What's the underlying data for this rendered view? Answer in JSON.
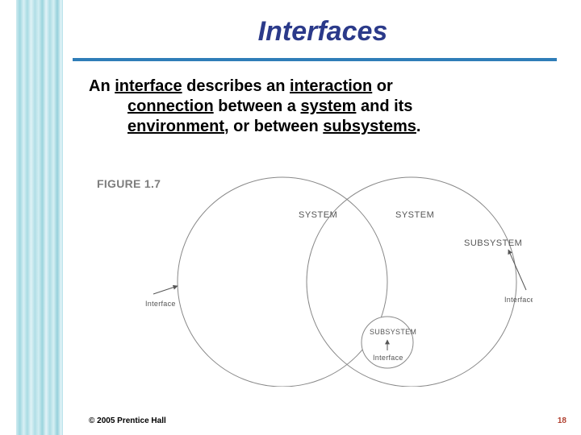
{
  "title": "Interfaces",
  "body": {
    "line1_a": "An ",
    "line1_b": "interface",
    "line1_c": " describes an ",
    "line1_d": "interaction",
    "line1_e": " or",
    "line2_a": "connection",
    "line2_b": " between a ",
    "line2_c": "system",
    "line2_d": " and its",
    "line3_a": "environment,",
    "line3_b": " or between ",
    "line3_c": "subsystems",
    "line3_d": "."
  },
  "figure": {
    "caption": "FIGURE 1.7",
    "labels": {
      "system_left": "SYSTEM",
      "system_right": "SYSTEM",
      "subsystem": "SUBSYSTEM",
      "subsystem_small": "SUBSYSTEM",
      "interface": "Interface"
    }
  },
  "footer": {
    "copyright": "© 2005  Prentice Hall",
    "page": "18"
  }
}
